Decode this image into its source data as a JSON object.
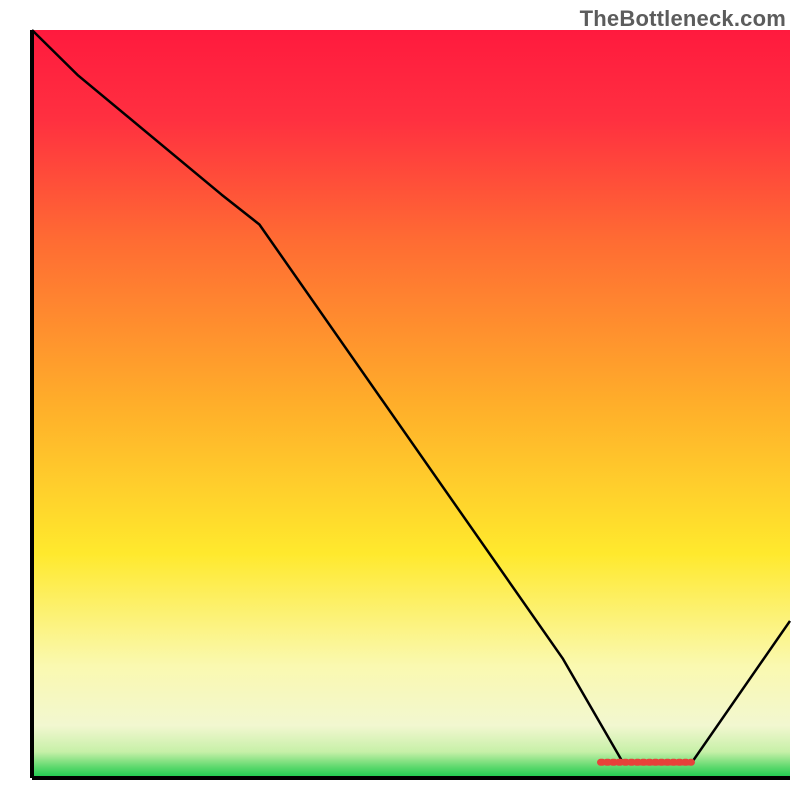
{
  "watermark": "TheBottleneck.com",
  "chart_data": {
    "type": "line",
    "title": "",
    "xlabel": "",
    "ylabel": "",
    "xlim": [
      0,
      100
    ],
    "ylim": [
      0,
      100
    ],
    "x": [
      0,
      6,
      25,
      30,
      70,
      78,
      87,
      100
    ],
    "values": [
      100,
      94,
      78,
      74,
      16,
      2,
      2,
      21
    ],
    "notes": "Curve descends from upper-left, bends slightly around x≈25-30, continues down to minimum plateau around x≈78-87 at y≈2, then rises to y≈21 at x=100. Background is a vertical rainbow gradient (red→orange→yellow→faint-yellow→green) with a thin green strip at the very bottom. Short red horizontal mark sits at the valley bottom.",
    "gradient_stops": [
      {
        "offset": 0.0,
        "color": "#ff1a3e"
      },
      {
        "offset": 0.12,
        "color": "#ff3040"
      },
      {
        "offset": 0.28,
        "color": "#ff6b33"
      },
      {
        "offset": 0.5,
        "color": "#ffae2a"
      },
      {
        "offset": 0.7,
        "color": "#ffe92d"
      },
      {
        "offset": 0.85,
        "color": "#faf9b0"
      },
      {
        "offset": 0.93,
        "color": "#f2f7d0"
      },
      {
        "offset": 0.965,
        "color": "#c7f0a8"
      },
      {
        "offset": 0.985,
        "color": "#5fd96e"
      },
      {
        "offset": 1.0,
        "color": "#18c94c"
      }
    ],
    "valley_mark": {
      "x0": 75,
      "x1": 87,
      "y": 2.1
    }
  }
}
